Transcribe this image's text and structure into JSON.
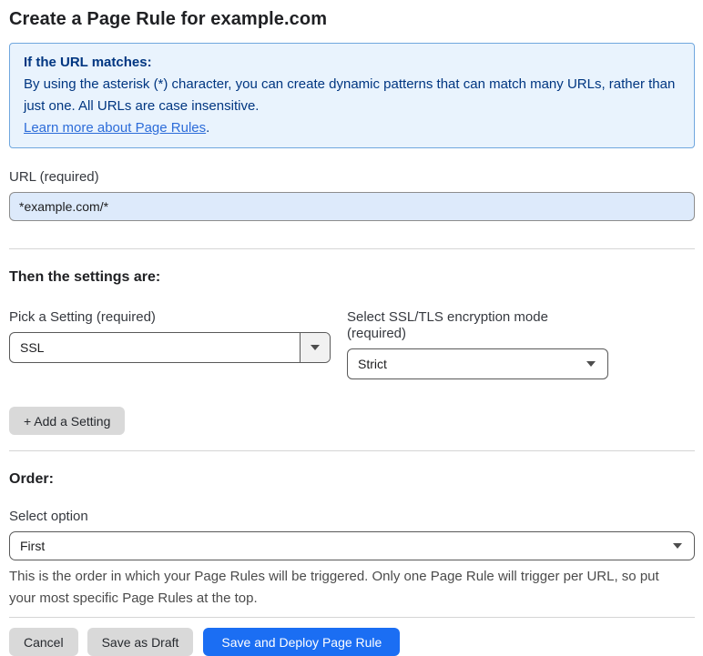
{
  "page": {
    "title": "Create a Page Rule for example.com"
  },
  "info_box": {
    "heading": "If the URL matches:",
    "body": "By using the asterisk (*) character, you can create dynamic patterns that can match many URLs, rather than just one. All URLs are case insensitive.",
    "link_label": "Learn more about Page Rules",
    "link_suffix": "."
  },
  "url_field": {
    "label": "URL (required)",
    "value": "*example.com/*"
  },
  "settings_section": {
    "heading": "Then the settings are:",
    "pick_setting": {
      "label": "Pick a Setting (required)",
      "value": "SSL"
    },
    "encryption_mode": {
      "label": "Select SSL/TLS encryption mode (required)",
      "value": "Strict"
    },
    "add_setting_label": "+ Add a Setting"
  },
  "order_section": {
    "heading": "Order:",
    "select_label": "Select option",
    "value": "First",
    "help_text": "This is the order in which your Page Rules will be triggered. Only one Page Rule will trigger per URL, so put your most specific Page Rules at the top."
  },
  "footer": {
    "cancel_label": "Cancel",
    "save_draft_label": "Save as Draft",
    "save_deploy_label": "Save and Deploy Page Rule"
  },
  "colors": {
    "info_background": "#e9f3fd",
    "info_border": "#70a7de",
    "info_text": "#003681",
    "link_blue": "#2c6cd9",
    "url_input_background": "#ddeafb",
    "primary_button_blue": "#1b6ef3",
    "gray_button": "#d9d9d9"
  },
  "icons": {
    "dropdown_arrow": "chevron-down"
  }
}
